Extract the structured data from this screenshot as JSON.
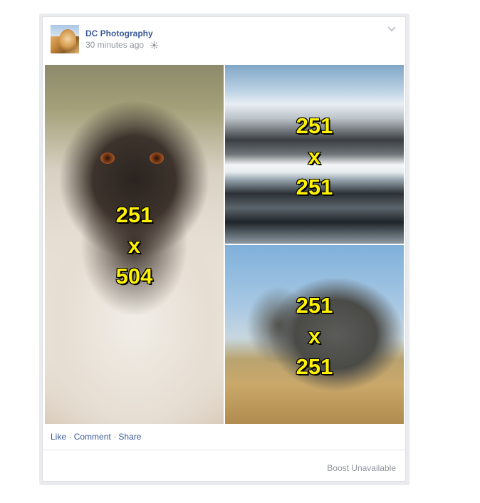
{
  "post": {
    "page_name": "DC Photography",
    "timestamp": "30 minutes ago",
    "globe_icon": "globe-icon",
    "menu_icon": "chevron-down-icon"
  },
  "photos": {
    "left": {
      "line1": "251",
      "line2": "x",
      "line3": "504"
    },
    "top_right": {
      "line1": "251",
      "line2": "x",
      "line3": "251"
    },
    "bottom_right": {
      "line1": "251",
      "line2": "x",
      "line3": "251"
    }
  },
  "actions": {
    "like": "Like",
    "sep1": "·",
    "comment": "Comment",
    "sep2": "·",
    "share": "Share"
  },
  "footer": {
    "boost": "Boost Unavailable"
  },
  "colors": {
    "link": "#3b5998",
    "muted": "#90949c",
    "overlay_text": "#fff200"
  }
}
